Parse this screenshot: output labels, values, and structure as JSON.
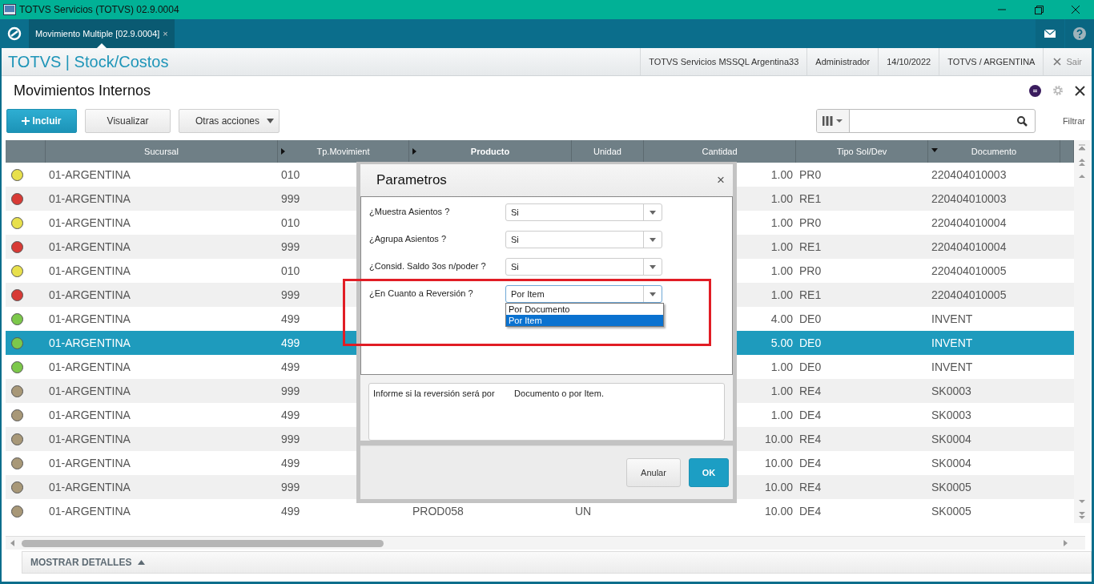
{
  "window": {
    "title": "TOTVS Servicios (TOTVS) 02.9.0004"
  },
  "tabs": [
    {
      "label": "Movimiento Multiple [02.9.0004]",
      "close": "×",
      "selected": true
    }
  ],
  "header": {
    "brand": "TOTVS | Stock/Costos",
    "info": [
      "TOTVS Servicios MSSQL Argentina33",
      "Administrador",
      "14/10/2022",
      "TOTVS / ARGENTINA"
    ],
    "exit": "Sair"
  },
  "page": {
    "title": "Movimientos Internos"
  },
  "toolbar": {
    "buttons": [
      {
        "label": "Incluir",
        "kind": "primary"
      },
      {
        "label": "Visualizar",
        "kind": "plain"
      },
      {
        "label": "Otras acciones",
        "kind": "menu"
      }
    ],
    "filter_label": "Filtrar"
  },
  "table": {
    "columns": [
      {
        "label": "Sucursal",
        "kind": "plain",
        "selected": false
      },
      {
        "label": "Tp.Movimient",
        "kind": "collapsed",
        "selected": false
      },
      {
        "label": "Producto",
        "kind": "collapsed",
        "selected": true
      },
      {
        "label": "Unidad",
        "kind": "plain",
        "selected": false
      },
      {
        "label": "Cantidad",
        "kind": "plain",
        "selected": false
      },
      {
        "label": "Tipo Sol/Dev",
        "kind": "plain",
        "selected": false
      },
      {
        "label": "Documento",
        "kind": "sorted",
        "selected": false
      }
    ],
    "rows": [
      {
        "color": "#e8e04c",
        "selected": false,
        "sucursal": "01-ARGENTINA",
        "tp": "010",
        "cantidad": "1.00",
        "tipo": "PR0",
        "documento": "220404010003"
      },
      {
        "color": "#d83a35",
        "selected": false,
        "sucursal": "01-ARGENTINA",
        "tp": "999",
        "cantidad": "1.00",
        "tipo": "RE1",
        "documento": "220404010003"
      },
      {
        "color": "#e8e04c",
        "selected": false,
        "sucursal": "01-ARGENTINA",
        "tp": "010",
        "cantidad": "1.00",
        "tipo": "PR0",
        "documento": "220404010004"
      },
      {
        "color": "#d83a35",
        "selected": false,
        "sucursal": "01-ARGENTINA",
        "tp": "999",
        "cantidad": "1.00",
        "tipo": "RE1",
        "documento": "220404010004"
      },
      {
        "color": "#e8e04c",
        "selected": false,
        "sucursal": "01-ARGENTINA",
        "tp": "010",
        "cantidad": "1.00",
        "tipo": "PR0",
        "documento": "220404010005"
      },
      {
        "color": "#d83a35",
        "selected": false,
        "sucursal": "01-ARGENTINA",
        "tp": "999",
        "cantidad": "1.00",
        "tipo": "RE1",
        "documento": "220404010005"
      },
      {
        "color": "#7cc84a",
        "selected": false,
        "sucursal": "01-ARGENTINA",
        "tp": "499",
        "cantidad": "4.00",
        "tipo": "DE0",
        "documento": "INVENT"
      },
      {
        "color": "#7cc84a",
        "selected": true,
        "sucursal": "01-ARGENTINA",
        "tp": "499",
        "cantidad": "5.00",
        "tipo": "DE0",
        "documento": "INVENT"
      },
      {
        "color": "#7cc84a",
        "selected": false,
        "sucursal": "01-ARGENTINA",
        "tp": "499",
        "cantidad": "1.00",
        "tipo": "DE0",
        "documento": "INVENT"
      },
      {
        "color": "#a89878",
        "selected": false,
        "sucursal": "01-ARGENTINA",
        "tp": "999",
        "cantidad": "1.00",
        "tipo": "RE4",
        "documento": "SK0003"
      },
      {
        "color": "#a89878",
        "selected": false,
        "sucursal": "01-ARGENTINA",
        "tp": "499",
        "cantidad": "1.00",
        "tipo": "DE4",
        "documento": "SK0003"
      },
      {
        "color": "#a89878",
        "selected": false,
        "sucursal": "01-ARGENTINA",
        "tp": "999",
        "cantidad": "10.00",
        "tipo": "RE4",
        "documento": "SK0004"
      },
      {
        "color": "#a89878",
        "selected": false,
        "sucursal": "01-ARGENTINA",
        "tp": "499",
        "cantidad": "10.00",
        "tipo": "DE4",
        "documento": "SK0004"
      },
      {
        "color": "#a89878",
        "selected": false,
        "sucursal": "01-ARGENTINA",
        "tp": "999",
        "cantidad": "10.00",
        "tipo": "RE4",
        "documento": "SK0005"
      },
      {
        "color": "#a89878",
        "selected": false,
        "sucursal": "01-ARGENTINA",
        "tp": "499",
        "producto": "PROD058",
        "unidad": "UN",
        "cantidad": "10.00",
        "tipo": "DE4",
        "documento": "SK0005"
      }
    ]
  },
  "footer": {
    "details": "MOSTRAR DETALLES"
  },
  "dialog": {
    "title": "Parametros",
    "close": "×",
    "params": [
      {
        "label": "¿Muestra Asientos ?",
        "value": "Si",
        "expanded": false
      },
      {
        "label": "¿Agrupa Asientos ?",
        "value": "Si",
        "expanded": false
      },
      {
        "label": "¿Consid. Saldo 3os n/poder ?",
        "value": "Si",
        "expanded": false
      },
      {
        "label": "¿En Cuanto a Reversión ?",
        "value": "Por Item",
        "expanded": true,
        "options": [
          {
            "label": "Por Documento",
            "selected": false
          },
          {
            "label": "Por Item",
            "selected": true
          }
        ]
      }
    ],
    "help": "Informe si la reversión será por        Documento o por Item.",
    "buttons": [
      {
        "label": "Anular",
        "kind": "secondary"
      },
      {
        "label": "OK",
        "kind": "primary"
      }
    ]
  }
}
